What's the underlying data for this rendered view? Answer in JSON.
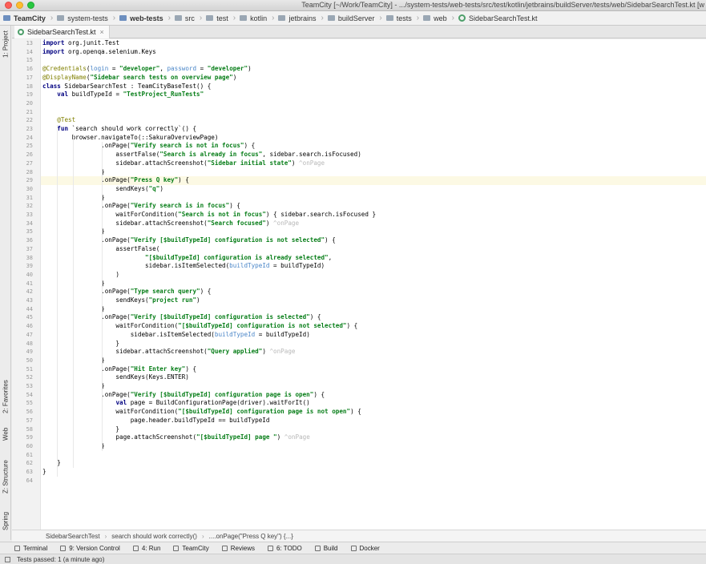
{
  "window": {
    "title": "TeamCity [~/Work/TeamCity] - .../system-tests/web-tests/src/test/kotlin/jetbrains/buildServer/tests/web/SidebarSearchTest.kt [w"
  },
  "nav_bar": {
    "crumbs": [
      "TeamCity",
      "system-tests",
      "web-tests",
      "src",
      "test",
      "kotlin",
      "jetbrains",
      "buildServer",
      "tests",
      "web",
      "SidebarSearchTest.kt"
    ]
  },
  "left_tool_strip": {
    "project": "1: Project",
    "favorites": "2: Favorites",
    "web": "Web",
    "structure": "Z: Structure",
    "spring": "Spring"
  },
  "editor_tab": {
    "label": "SidebarSearchTest.kt",
    "close": "×"
  },
  "editor": {
    "current_line": 29,
    "lines": [
      {
        "n": "13",
        "code": "import org.junit.Test"
      },
      {
        "n": "14",
        "code": "import org.openqa.selenium.Keys"
      },
      {
        "n": "15",
        "code": ""
      },
      {
        "n": "16",
        "code": "@Credentials(login = \"developer\", password = \"developer\")"
      },
      {
        "n": "17",
        "code": "@DisplayName(\"Sidebar search tests on overview page\")"
      },
      {
        "n": "18",
        "code": "class SidebarSearchTest : TeamCityBaseTest() {"
      },
      {
        "n": "19",
        "code": "    val buildTypeId = \"TestProject_RunTests\""
      },
      {
        "n": "20",
        "code": ""
      },
      {
        "n": "21",
        "code": ""
      },
      {
        "n": "22",
        "code": "    @Test"
      },
      {
        "n": "23",
        "code": "    fun `search should work correctly`() {"
      },
      {
        "n": "24",
        "code": "        browser.navigateTo(::SakuraOverviewPage)"
      },
      {
        "n": "25",
        "code": "                .onPage(\"Verify search is not in focus\") {"
      },
      {
        "n": "26",
        "code": "                    assertFalse(\"Search is already in focus\", sidebar.search.isFocused)"
      },
      {
        "n": "27",
        "code": "                    sidebar.attachScreenshot(\"Sidebar initial state\") ^onPage"
      },
      {
        "n": "28",
        "code": "                }"
      },
      {
        "n": "29",
        "code": "                .onPage(\"Press Q key\") {"
      },
      {
        "n": "30",
        "code": "                    sendKeys(\"q\")"
      },
      {
        "n": "31",
        "code": "                }"
      },
      {
        "n": "32",
        "code": "                .onPage(\"Verify search is in focus\") {"
      },
      {
        "n": "33",
        "code": "                    waitForCondition(\"Search is not in focus\") { sidebar.search.isFocused }"
      },
      {
        "n": "34",
        "code": "                    sidebar.attachScreenshot(\"Search focused\") ^onPage"
      },
      {
        "n": "35",
        "code": "                }"
      },
      {
        "n": "36",
        "code": "                .onPage(\"Verify [$buildTypeId] configuration is not selected\") {"
      },
      {
        "n": "37",
        "code": "                    assertFalse("
      },
      {
        "n": "38",
        "code": "                            \"[$buildTypeId] configuration is already selected\","
      },
      {
        "n": "39",
        "code": "                            sidebar.isItemSelected(buildTypeId = buildTypeId)"
      },
      {
        "n": "40",
        "code": "                    )"
      },
      {
        "n": "41",
        "code": "                }"
      },
      {
        "n": "42",
        "code": "                .onPage(\"Type search query\") {"
      },
      {
        "n": "43",
        "code": "                    sendKeys(\"project run\")"
      },
      {
        "n": "44",
        "code": "                }"
      },
      {
        "n": "45",
        "code": "                .onPage(\"Verify [$buildTypeId] configuration is selected\") {"
      },
      {
        "n": "46",
        "code": "                    waitForCondition(\"[$buildTypeId] configuration is not selected\") {"
      },
      {
        "n": "47",
        "code": "                        sidebar.isItemSelected(buildTypeId = buildTypeId)"
      },
      {
        "n": "48",
        "code": "                    }"
      },
      {
        "n": "49",
        "code": "                    sidebar.attachScreenshot(\"Query applied\") ^onPage"
      },
      {
        "n": "50",
        "code": "                }"
      },
      {
        "n": "51",
        "code": "                .onPage(\"Hit Enter key\") {"
      },
      {
        "n": "52",
        "code": "                    sendKeys(Keys.ENTER)"
      },
      {
        "n": "53",
        "code": "                }"
      },
      {
        "n": "54",
        "code": "                .onPage(\"Verify [$buildTypeId] configuration page is open\") {"
      },
      {
        "n": "55",
        "code": "                    val page = BuildConfigurationPage(driver).waitForIt()"
      },
      {
        "n": "56",
        "code": "                    waitForCondition(\"[$buildTypeId] configuration page is not open\") {"
      },
      {
        "n": "57",
        "code": "                        page.header.buildTypeId == buildTypeId"
      },
      {
        "n": "58",
        "code": "                    }"
      },
      {
        "n": "59",
        "code": "                    page.attachScreenshot(\"[$buildTypeId] page \") ^onPage"
      },
      {
        "n": "60",
        "code": "                }"
      },
      {
        "n": "61",
        "code": ""
      },
      {
        "n": "62",
        "code": "    }"
      },
      {
        "n": "63",
        "code": "}"
      },
      {
        "n": "64",
        "code": ""
      }
    ]
  },
  "code_breadcrumbs": [
    "SidebarSearchTest",
    "search should work correctly()",
    "....onPage(\"Press Q key\") {...}"
  ],
  "tool_windows": [
    {
      "label": "Terminal",
      "icon": "terminal-icon"
    },
    {
      "label": "9: Version Control",
      "icon": "vcs-icon"
    },
    {
      "label": "4: Run",
      "icon": "run-icon"
    },
    {
      "label": "TeamCity",
      "icon": "teamcity-icon"
    },
    {
      "label": "Reviews",
      "icon": "reviews-icon"
    },
    {
      "label": "6: TODO",
      "icon": "todo-icon"
    },
    {
      "label": "Build",
      "icon": "build-icon"
    },
    {
      "label": "Docker",
      "icon": "docker-icon"
    }
  ],
  "status": {
    "text": "Tests passed: 1 (a minute ago)"
  }
}
